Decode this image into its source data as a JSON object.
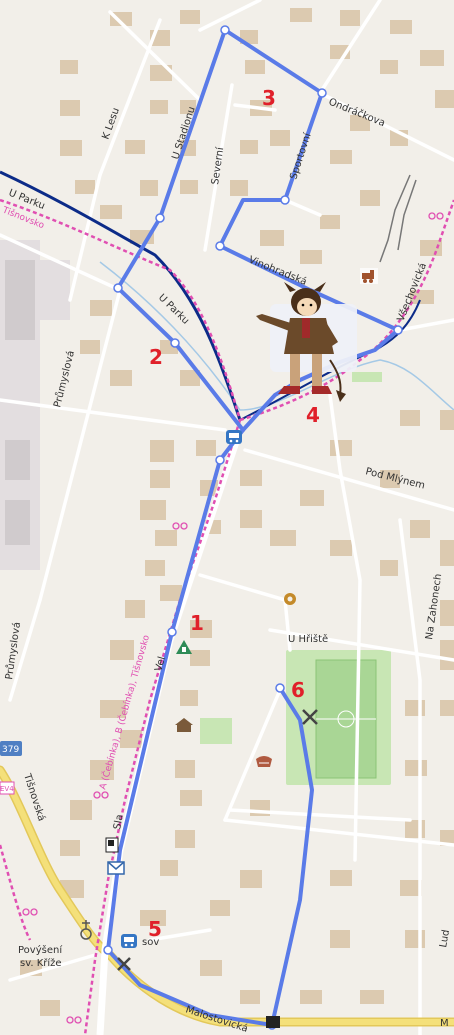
{
  "map": {
    "colors": {
      "background": "#f2efe9",
      "building": "#dccab0",
      "route": "#5a7be8",
      "railway": "#0c2b88",
      "bike_route": "#e04fb2",
      "yellow_road": "#f4e07a",
      "grass": "#c8e6b4",
      "number": "#e0202a"
    },
    "street_labels": {
      "u_parku_top": "U Parku",
      "tisnovsko_top": "Tišnovsko",
      "k_lesu": "K Lesu",
      "u_stadionu": "U Stadionu",
      "severni": "Severní",
      "ondrackova": "Ondráčkova",
      "sportovni": "Sportovní",
      "vinohradska": "Vinohradská",
      "vsechovicka": "Všechovická",
      "u_parku_mid": "U Parku",
      "prumyslova_top": "Průmyslová",
      "pod_mlynem": "Pod Mlýnem",
      "na_zahonech": "Na Zahonech",
      "u_hriste": "U Hřiště",
      "prumyslova_bottom": "Průmyslová",
      "tisnovska": "Tišnovská",
      "ev4": "EV4",
      "road_379": "379",
      "bike_route_label": "A (Čebínka), B (Čebínka), Tišnovsko",
      "vrsovice_short": "Vel",
      "malostovicka": "Malostovická",
      "povyseni": "Povýšení",
      "sv_krize": "sv. Kříže",
      "sov": "sov",
      "lud": "Lud",
      "m_edge": "M",
      "sla": "Sla"
    },
    "waypoints": [
      "1",
      "2",
      "3",
      "4",
      "5",
      "6"
    ],
    "icons": [
      "train-icon",
      "bus-stop-icon",
      "pharmacy-icon",
      "gear-icon",
      "church-icon",
      "post-office-icon",
      "stadium-icon",
      "tools-icon",
      "cross-icon",
      "flag-icon"
    ]
  }
}
